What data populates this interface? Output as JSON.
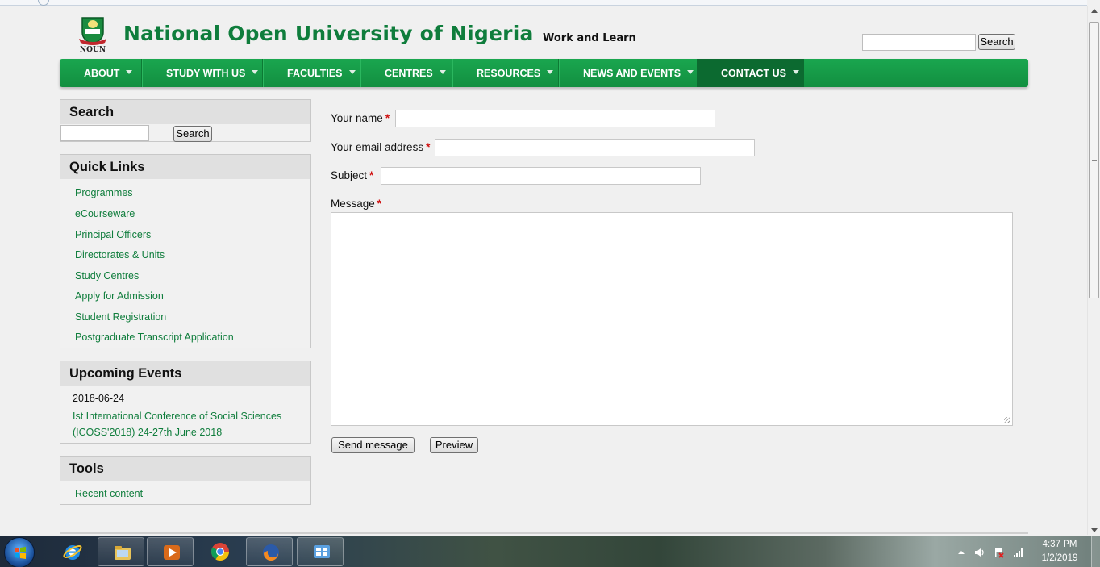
{
  "site": {
    "name": "National Open University of Nigeria",
    "slogan": "Work and Learn",
    "logo_text": "NOUN"
  },
  "header_search": {
    "button": "Search"
  },
  "nav": {
    "items": [
      {
        "label": "ABOUT"
      },
      {
        "label": "STUDY WITH US"
      },
      {
        "label": "FACULTIES"
      },
      {
        "label": "CENTRES"
      },
      {
        "label": "RESOURCES"
      },
      {
        "label": "NEWS AND EVENTS"
      },
      {
        "label": "CONTACT US"
      }
    ],
    "active": "CONTACT US"
  },
  "sidebar": {
    "search": {
      "title": "Search",
      "button": "Search"
    },
    "quick_links": {
      "title": "Quick Links",
      "items": [
        "Programmes",
        "eCourseware",
        "Principal Officers",
        "Directorates & Units",
        "Study Centres",
        "Apply for Admission",
        "Student Registration",
        "Postgraduate Transcript Application"
      ]
    },
    "events": {
      "title": "Upcoming Events",
      "date": "2018-06-24",
      "link": "Ist International Conference of Social Sciences (ICOSS'2018) 24-27th June 2018"
    },
    "tools": {
      "title": "Tools",
      "items": [
        "Recent content"
      ]
    }
  },
  "form": {
    "name_label": "Your name",
    "email_label": "Your email address",
    "subject_label": "Subject",
    "message_label": "Message",
    "required_marker": "*",
    "send_button": "Send message",
    "preview_button": "Preview"
  },
  "taskbar": {
    "time": "4:37 PM",
    "date": "1/2/2019"
  },
  "colors": {
    "brand_green": "#0f7d3c",
    "nav_green": "#16a34a",
    "nav_active": "#0c6a30",
    "required_red": "#d01010"
  }
}
